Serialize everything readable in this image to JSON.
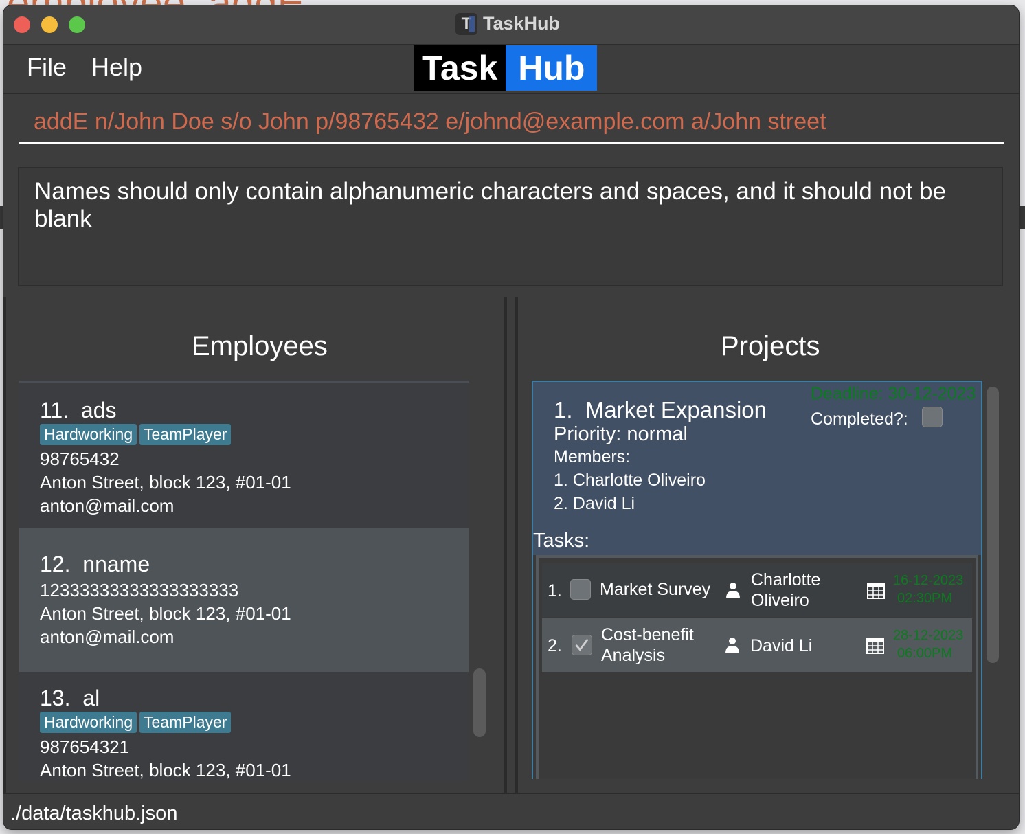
{
  "background": {
    "text": "employee: addE"
  },
  "window": {
    "title": "TaskHub"
  },
  "menu": {
    "file": "File",
    "help": "Help"
  },
  "logo": {
    "part1": "Task",
    "part2": "Hub"
  },
  "command": {
    "value": "addE n/John Doe s/o John p/98765432 e/johnd@example.com a/John street"
  },
  "result": {
    "message": "Names should only contain alphanumeric characters and spaces, and it should not be blank"
  },
  "employees": {
    "title": "Employees",
    "items": [
      {
        "index": "11.",
        "name": "ads",
        "tags": [
          "Hardworking",
          "TeamPlayer"
        ],
        "phone": "98765432",
        "address": "Anton Street, block 123, #01-01",
        "email": "anton@mail.com"
      },
      {
        "index": "12.",
        "name": "nname",
        "tags": [],
        "phone": "12333333333333333333",
        "address": "Anton Street, block 123, #01-01",
        "email": "anton@mail.com"
      },
      {
        "index": "13.",
        "name": "al",
        "tags": [
          "Hardworking",
          "TeamPlayer"
        ],
        "phone": "987654321",
        "address": "Anton Street, block 123, #01-01",
        "email": ""
      }
    ]
  },
  "projects": {
    "title": "Projects",
    "items": [
      {
        "index": "1.",
        "name": "Market Expansion",
        "priority": "Priority: normal",
        "members_label": "Members:",
        "members": [
          "1. Charlotte Oliveiro",
          "2. David Li"
        ],
        "deadline": "Deadline: 30-12-2023",
        "completed_label": "Completed?:",
        "completed": false,
        "tasks_label": "Tasks:",
        "tasks": [
          {
            "num": "1.",
            "title_line1": "Market Survey",
            "title_line2": "",
            "done": false,
            "assignee_line1": "Charlotte",
            "assignee_line2": "Oliveiro",
            "date": "16-12-2023",
            "time": "02:30PM"
          },
          {
            "num": "2.",
            "title_line1": "Cost-benefit",
            "title_line2": "Analysis",
            "done": true,
            "assignee_line1": "David Li",
            "assignee_line2": "",
            "date": "28-12-2023",
            "time": "06:00PM"
          }
        ]
      }
    ]
  },
  "status": {
    "path": "./data/taskhub.json"
  },
  "colors": {
    "accent": "#1672e8",
    "command_text": "#d06a4e",
    "deadline": "#0c7a1f",
    "tag": "#3e7b91",
    "project_header": "#415064"
  }
}
